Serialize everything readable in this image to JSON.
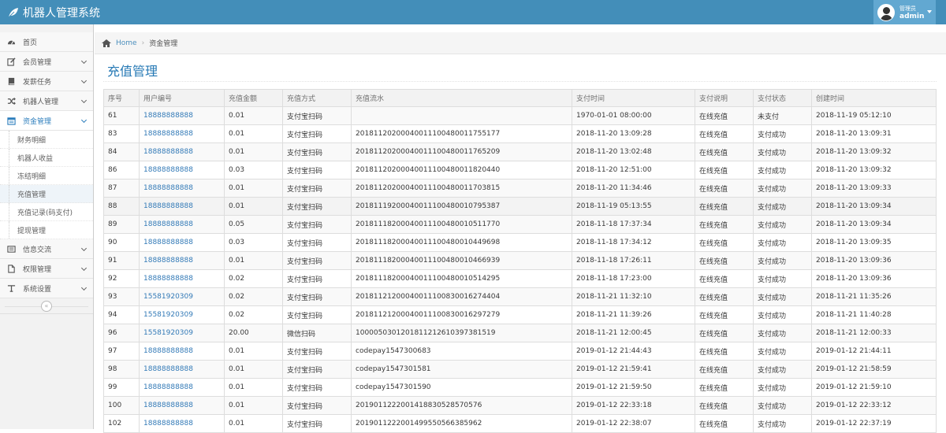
{
  "app": {
    "title": "机器人管理系统"
  },
  "user": {
    "role": "管理员",
    "name": "admin"
  },
  "sidebar": {
    "items": [
      {
        "key": "home",
        "label": "首页",
        "icon": "dashboard-icon",
        "chevron": false
      },
      {
        "key": "members",
        "label": "会员管理",
        "icon": "edit-icon",
        "chevron": true
      },
      {
        "key": "tasks",
        "label": "发薪任务",
        "icon": "book-icon",
        "chevron": true
      },
      {
        "key": "robots",
        "label": "机器人管理",
        "icon": "shuffle-icon",
        "chevron": true
      },
      {
        "key": "funds",
        "label": "资金管理",
        "icon": "calendar-icon",
        "chevron": true,
        "open": true,
        "children": [
          "财务明细",
          "机器人收益",
          "冻结明细",
          "充值管理",
          "充值记录(码支付)",
          "提现管理"
        ]
      },
      {
        "key": "messages",
        "label": "信息交流",
        "icon": "list-icon",
        "chevron": true
      },
      {
        "key": "permissions",
        "label": "权限管理",
        "icon": "file-icon",
        "chevron": true
      },
      {
        "key": "settings",
        "label": "系统设置",
        "icon": "text-icon",
        "chevron": true
      }
    ],
    "collapse_glyph": "«"
  },
  "breadcrumb": {
    "home": "Home",
    "separator": "›",
    "current": "资金管理"
  },
  "page": {
    "title": "充值管理"
  },
  "table": {
    "columns": [
      "序号",
      "用户编号",
      "充值金额",
      "充值方式",
      "充值流水",
      "支付时间",
      "支付说明",
      "支付状态",
      "创建时间"
    ],
    "rows": [
      [
        "61",
        "18888888888",
        "0.01",
        "支付宝扫码",
        "",
        "1970-01-01 08:00:00",
        "在线充值",
        "未支付",
        "2018-11-19 05:12:10"
      ],
      [
        "83",
        "18888888888",
        "0.01",
        "支付宝扫码",
        "2018112020004001110048001175517​7",
        "2018-11-20 13:09:28",
        "在线充值",
        "支付成功",
        "2018-11-20 13:09:31"
      ],
      [
        "84",
        "18888888888",
        "0.01",
        "支付宝扫码",
        "2018112020004001110048001176520​9",
        "2018-11-20 13:02:48",
        "在线充值",
        "支付成功",
        "2018-11-20 13:09:32"
      ],
      [
        "86",
        "18888888888",
        "0.03",
        "支付宝扫码",
        "2018112020004001110048001182044​0",
        "2018-11-20 12:51:00",
        "在线充值",
        "支付成功",
        "2018-11-20 13:09:32"
      ],
      [
        "87",
        "18888888888",
        "0.01",
        "支付宝扫码",
        "2018112020004001110048001170381​5",
        "2018-11-20 11:34:46",
        "在线充值",
        "支付成功",
        "2018-11-20 13:09:33"
      ],
      [
        "88",
        "18888888888",
        "0.01",
        "支付宝扫码",
        "2018111920004001110048001079538​7",
        "2018-11-19 05:13:55",
        "在线充值",
        "支付成功",
        "2018-11-20 13:09:34"
      ],
      [
        "89",
        "18888888888",
        "0.05",
        "支付宝扫码",
        "2018111820004001110048001051177​0",
        "2018-11-18 17:37:34",
        "在线充值",
        "支付成功",
        "2018-11-20 13:09:34"
      ],
      [
        "90",
        "18888888888",
        "0.03",
        "支付宝扫码",
        "2018111820004001110048001044969​8",
        "2018-11-18 17:34:12",
        "在线充值",
        "支付成功",
        "2018-11-20 13:09:35"
      ],
      [
        "91",
        "18888888888",
        "0.01",
        "支付宝扫码",
        "2018111820004001110048001046693​9",
        "2018-11-18 17:26:11",
        "在线充值",
        "支付成功",
        "2018-11-20 13:09:36"
      ],
      [
        "92",
        "18888888888",
        "0.02",
        "支付宝扫码",
        "2018111820004001110048001051429​5",
        "2018-11-18 17:23:00",
        "在线充值",
        "支付成功",
        "2018-11-20 13:09:36"
      ],
      [
        "93",
        "15581920309",
        "0.02",
        "支付宝扫码",
        "2018112120004001110083001627440​4",
        "2018-11-21 11:32:10",
        "在线充值",
        "支付成功",
        "2018-11-21 11:35:26"
      ],
      [
        "94",
        "15581920309",
        "0.02",
        "支付宝扫码",
        "2018112120004001110083001629727​9",
        "2018-11-21 11:39:26",
        "在线充值",
        "支付成功",
        "2018-11-21 11:40:28"
      ],
      [
        "96",
        "15581920309",
        "20.00",
        "微信扫码",
        "1000050301201811212610397381519",
        "2018-11-21 12:00:45",
        "在线充值",
        "支付成功",
        "2018-11-21 12:00:33"
      ],
      [
        "97",
        "18888888888",
        "0.01",
        "支付宝扫码",
        "codepay1547300683",
        "2019-01-12 21:44:43",
        "在线充值",
        "支付成功",
        "2019-01-12 21:44:11"
      ],
      [
        "98",
        "18888888888",
        "0.01",
        "支付宝扫码",
        "codepay1547301581",
        "2019-01-12 21:59:41",
        "在线充值",
        "支付成功",
        "2019-01-12 21:58:59"
      ],
      [
        "99",
        "18888888888",
        "0.01",
        "支付宝扫码",
        "codepay1547301590",
        "2019-01-12 21:59:50",
        "在线充值",
        "支付成功",
        "2019-01-12 21:59:10"
      ],
      [
        "100",
        "18888888888",
        "0.01",
        "支付宝扫码",
        "2019011222001418830528570576",
        "2019-01-12 22:33:18",
        "在线充值",
        "支付成功",
        "2019-01-12 22:33:12"
      ],
      [
        "102",
        "18888888888",
        "0.01",
        "支付宝扫码",
        "2019011222001499550566385962",
        "2019-01-12 22:38:07",
        "在线充值",
        "支付成功",
        "2019-01-12 22:37:19"
      ]
    ]
  },
  "colors": {
    "navbar": "#438eb9",
    "user_box": "#62a8d1",
    "link": "#337ab7",
    "title": "#2679b5"
  }
}
